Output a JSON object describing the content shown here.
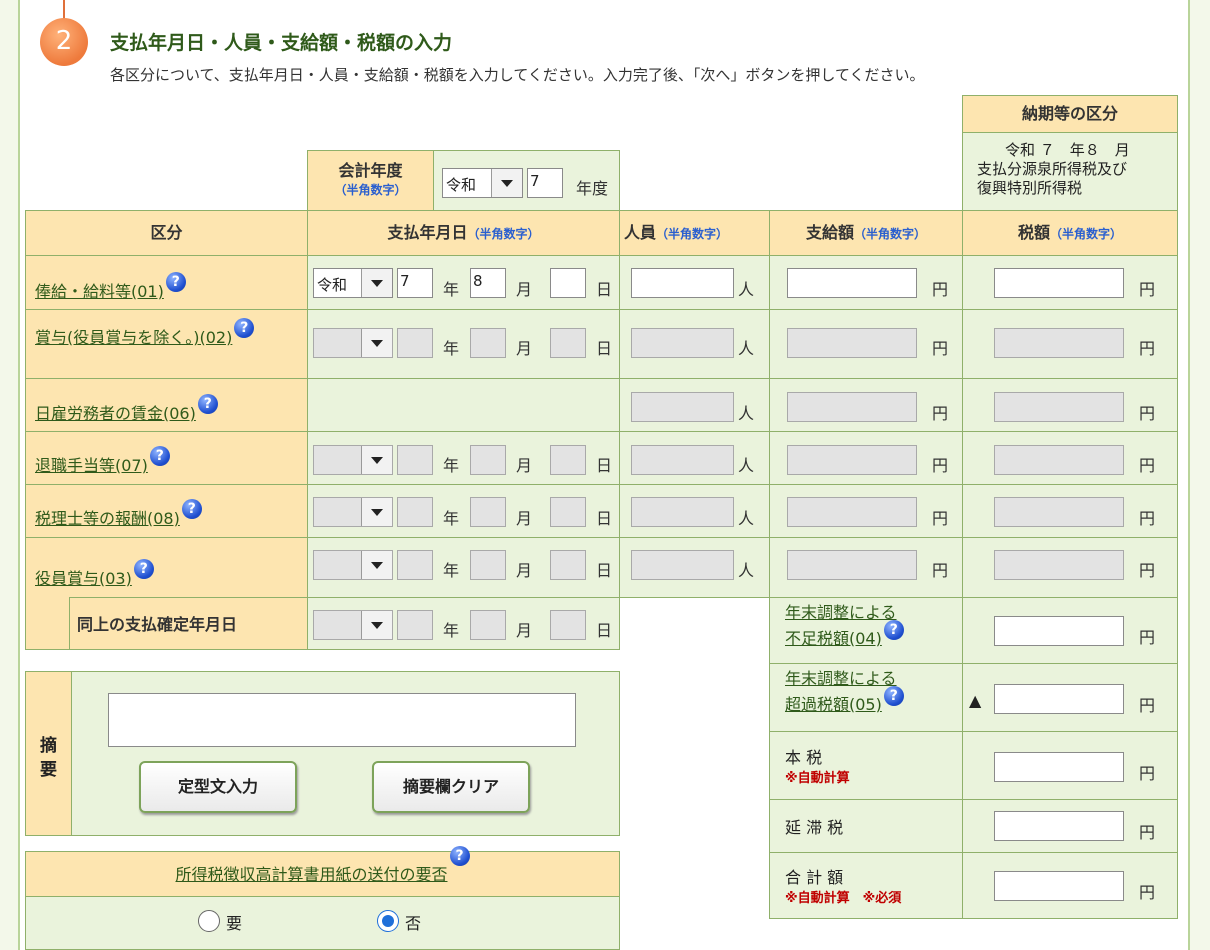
{
  "section": {
    "number": "2",
    "title": "支払年月日・人員・支給額・税額の入力",
    "desc": "各区分について、支払年月日・人員・支給額・税額を入力してください。入力完了後、「次へ」ボタンを押してください。"
  },
  "noki": {
    "header": "納期等の区分",
    "line1": "令和 ７　年８　月",
    "line2": "支払分源泉所得税及び",
    "line3": "復興特別所得税"
  },
  "fiscal": {
    "label": "会計年度",
    "hint": "（半角数字）",
    "era": "令和",
    "year": "7",
    "unit": "年度"
  },
  "headers": {
    "kubun": "区分",
    "date": "支払年月日",
    "date_hint": "（半角数字）",
    "people": "人員",
    "people_hint": "（半角数字）",
    "pay": "支給額",
    "pay_hint": "（半角数字）",
    "tax": "税額",
    "tax_hint": "（半角数字）"
  },
  "units": {
    "year": "年",
    "month": "月",
    "day": "日",
    "person": "人",
    "yen": "円"
  },
  "rows": [
    {
      "label": "俸給・給料等(01)",
      "era": "令和",
      "year": "7",
      "month": "8",
      "day": ""
    },
    {
      "label": "賞与(役員賞与を除く。)(02)",
      "era": "",
      "year": "",
      "month": "",
      "day": ""
    },
    {
      "label": "日雇労務者の賃金(06)",
      "era": "",
      "year": "",
      "month": "",
      "day": ""
    },
    {
      "label": "退職手当等(07)",
      "era": "",
      "year": "",
      "month": "",
      "day": ""
    },
    {
      "label": "税理士等の報酬(08)",
      "era": "",
      "year": "",
      "month": "",
      "day": ""
    },
    {
      "label": "役員賞与(03)",
      "era": "",
      "year": "",
      "month": "",
      "day": ""
    }
  ],
  "confirm_label": "同上の支払確定年月日",
  "adjust": {
    "shortage_l1": "年末調整による",
    "shortage_l2": "不足税額(04)",
    "excess_l1": "年末調整による",
    "excess_l2": "超過税額(05)",
    "triangle": "▲",
    "honzei": "本 税",
    "auto": "※自動計算",
    "entai": "延 滞 税",
    "total": "合 計 額",
    "total_note": "※自動計算　※必須"
  },
  "tekiyo": {
    "label1": "摘",
    "label2": "要",
    "value": "",
    "btn_template": "定型文入力",
    "btn_clear": "摘要欄クリア"
  },
  "sofu": {
    "title": "所得税徴収高計算書用紙の送付の要否",
    "yes": "要",
    "no": "否",
    "selected": "no"
  },
  "help_glyph": "?"
}
